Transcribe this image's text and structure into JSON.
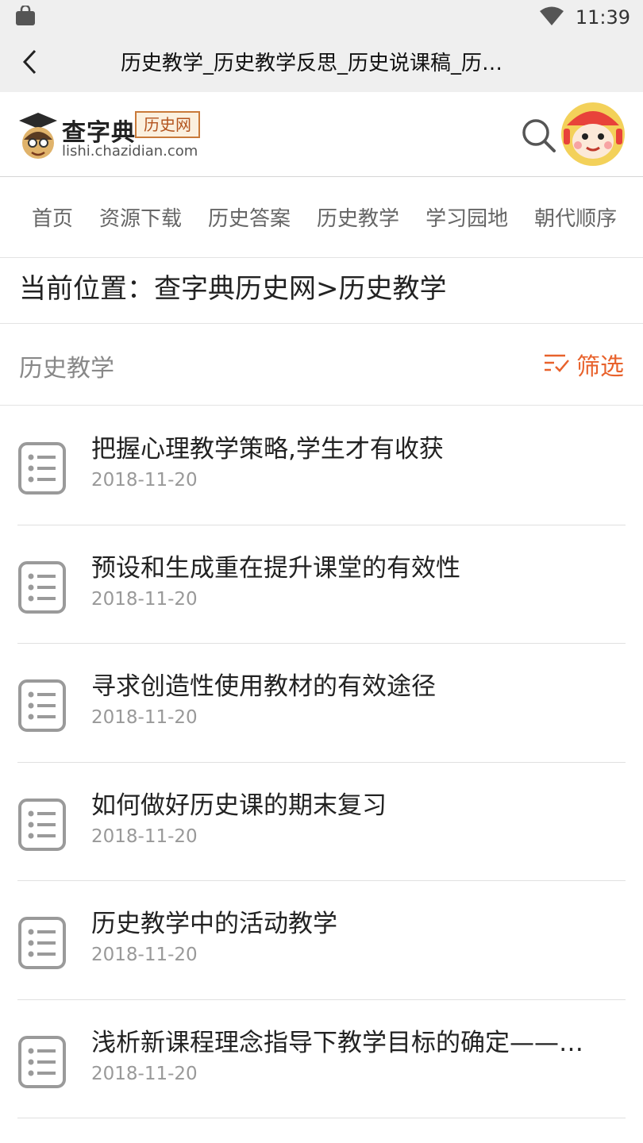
{
  "status_bar": {
    "time": "11:39"
  },
  "title_bar": {
    "title": "历史教学_历史教学反思_历史说课稿_历…"
  },
  "site_header": {
    "logo_name": "查字典",
    "logo_badge": "历史网",
    "logo_url": "lishi.chazidian.com"
  },
  "nav": {
    "items": [
      {
        "label": "首页"
      },
      {
        "label": "资源下载"
      },
      {
        "label": "历史答案"
      },
      {
        "label": "历史教学"
      },
      {
        "label": "学习园地"
      },
      {
        "label": "朝代顺序"
      }
    ]
  },
  "breadcrumb": {
    "text": "当前位置：查字典历史网>历史教学"
  },
  "section": {
    "title": "历史教学",
    "filter_label": "筛选",
    "accent_color": "#e8622c"
  },
  "articles": [
    {
      "title": "把握心理教学策略,学生才有收获",
      "date": "2018-11-20"
    },
    {
      "title": "预设和生成重在提升课堂的有效性",
      "date": "2018-11-20"
    },
    {
      "title": "寻求创造性使用教材的有效途径",
      "date": "2018-11-20"
    },
    {
      "title": "如何做好历史课的期末复习",
      "date": "2018-11-20"
    },
    {
      "title": "历史教学中的活动教学",
      "date": "2018-11-20"
    },
    {
      "title": "浅析新课程理念指导下教学目标的确定——…",
      "date": "2018-11-20"
    }
  ],
  "icons": {
    "status_left": "shopping-bag-icon",
    "wifi": "wifi-icon",
    "back": "back-arrow-icon",
    "search": "search-icon",
    "avatar": "avatar-icon",
    "filter": "filter-icon",
    "article": "list-document-icon"
  }
}
